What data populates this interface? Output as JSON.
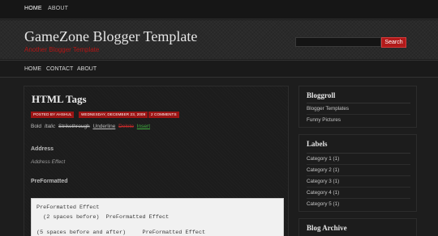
{
  "topbar": {
    "items": [
      {
        "label": "HOME",
        "active": true
      },
      {
        "label": "ABOUT",
        "active": false
      }
    ]
  },
  "header": {
    "title": "GameZone Blogger Template",
    "description": "Another Blogger Template",
    "search_button": "Search"
  },
  "nav": {
    "items": [
      {
        "label": "HOME"
      },
      {
        "label": "CONTACT"
      },
      {
        "label": "ABOUT"
      }
    ]
  },
  "post": {
    "title": "HTML Tags",
    "meta": {
      "author": "POSTED BY AHSHUL",
      "date": "WEDNESDAY, DECEMBER 23, 2009",
      "comments": "2 COMMENTS"
    },
    "formatting": {
      "bold": "Bold",
      "italic": "Italic",
      "strike": "Strikethrough",
      "underline": "Underline",
      "delete": "Delete",
      "insert": "Insert"
    },
    "address_heading": "Address",
    "address_text": "Address Effect",
    "preformatted_heading": "PreFormatted",
    "preformatted_lines": [
      "PreFormatted Effect",
      "  (2 spaces before)  PreFormatted Effect",
      "(5 spaces before and after)     PreFormatted Effect"
    ]
  },
  "sidebar": {
    "blogroll": {
      "title": "Bloggroll",
      "items": [
        "Blogger Templates",
        "Funny Pictures"
      ]
    },
    "labels": {
      "title": "Labels",
      "items": [
        "Category 1 (1)",
        "Category 2 (1)",
        "Category 3 (1)",
        "Category 4 (1)",
        "Category 5 (1)"
      ]
    },
    "archive": {
      "title": "Blog Archive"
    }
  },
  "colors": {
    "accent": "#b11a1a",
    "insert": "#3fae3f",
    "background": "#1d1d1d"
  }
}
